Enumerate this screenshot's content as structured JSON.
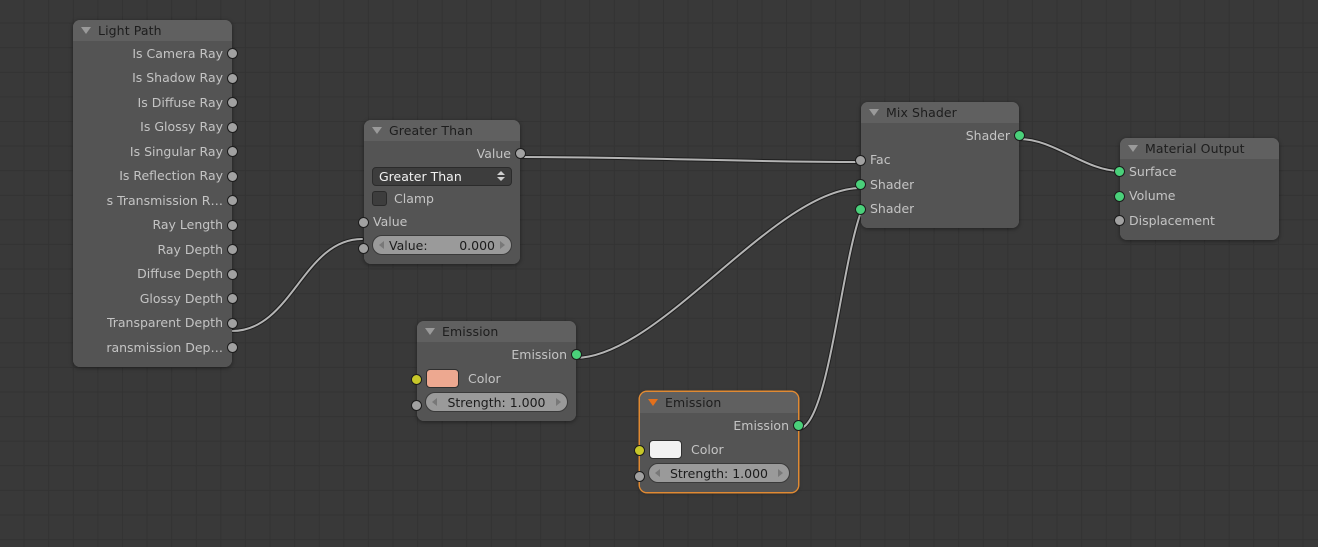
{
  "editor": {
    "name": "blender-shader-node-editor",
    "background_color": "#393939",
    "grid_color": "#333333",
    "wire_color": "#b4b4b4",
    "wire_outline_color": "#1e1e1e",
    "selection_color": "#e08a33"
  },
  "socket_colors": {
    "gray": "#a1a1a1",
    "green": "#4ad07a",
    "yellow": "#c7c729"
  },
  "nodes": {
    "light_path": {
      "title": "Light Path",
      "outputs": [
        {
          "label": "Is Camera Ray",
          "socket": "gray"
        },
        {
          "label": "Is Shadow Ray",
          "socket": "gray"
        },
        {
          "label": "Is Diffuse Ray",
          "socket": "gray"
        },
        {
          "label": "Is Glossy Ray",
          "socket": "gray"
        },
        {
          "label": "Is Singular Ray",
          "socket": "gray"
        },
        {
          "label": "Is Reflection Ray",
          "socket": "gray"
        },
        {
          "label": "s Transmission R…",
          "socket": "gray"
        },
        {
          "label": "Ray Length",
          "socket": "gray"
        },
        {
          "label": "Ray Depth",
          "socket": "gray"
        },
        {
          "label": "Diffuse Depth",
          "socket": "gray"
        },
        {
          "label": "Glossy Depth",
          "socket": "gray"
        },
        {
          "label": "Transparent Depth",
          "socket": "gray"
        },
        {
          "label": "ransmission Dep…",
          "socket": "gray"
        }
      ]
    },
    "greater_than": {
      "title": "Greater Than",
      "output_label": "Value",
      "output_socket": "gray",
      "operation_dropdown": "Greater Than",
      "clamp_label": "Clamp",
      "clamp_checked": false,
      "input_label": "Value",
      "input_socket": "gray",
      "value_slider_name": "Value:",
      "value_slider_value": "0.000",
      "value_socket": "gray"
    },
    "emission_1": {
      "title": "Emission",
      "selected": false,
      "output_label": "Emission",
      "output_socket": "green",
      "color_label": "Color",
      "color_value": "#eda890",
      "color_socket": "yellow",
      "strength_label": "Strength: 1.000",
      "strength_socket": "gray"
    },
    "emission_2": {
      "title": "Emission",
      "selected": true,
      "output_label": "Emission",
      "output_socket": "green",
      "color_label": "Color",
      "color_value": "#f2f2f2",
      "color_socket": "yellow",
      "strength_label": "Strength: 1.000",
      "strength_socket": "gray"
    },
    "mix_shader": {
      "title": "Mix Shader",
      "output_label": "Shader",
      "output_socket": "green",
      "inputs": [
        {
          "label": "Fac",
          "socket": "gray"
        },
        {
          "label": "Shader",
          "socket": "green"
        },
        {
          "label": "Shader",
          "socket": "green"
        }
      ]
    },
    "material_output": {
      "title": "Material Output",
      "inputs": [
        {
          "label": "Surface",
          "socket": "green"
        },
        {
          "label": "Volume",
          "socket": "green"
        },
        {
          "label": "Displacement",
          "socket": "gray"
        }
      ]
    }
  },
  "links": [
    {
      "from": "light_path.Transparent Depth",
      "to": "greater_than.Value"
    },
    {
      "from": "greater_than.Value",
      "to": "mix_shader.Fac"
    },
    {
      "from": "emission_1.Emission",
      "to": "mix_shader.Shader1"
    },
    {
      "from": "emission_2.Emission",
      "to": "mix_shader.Shader2"
    },
    {
      "from": "mix_shader.Shader",
      "to": "material_output.Surface"
    }
  ]
}
